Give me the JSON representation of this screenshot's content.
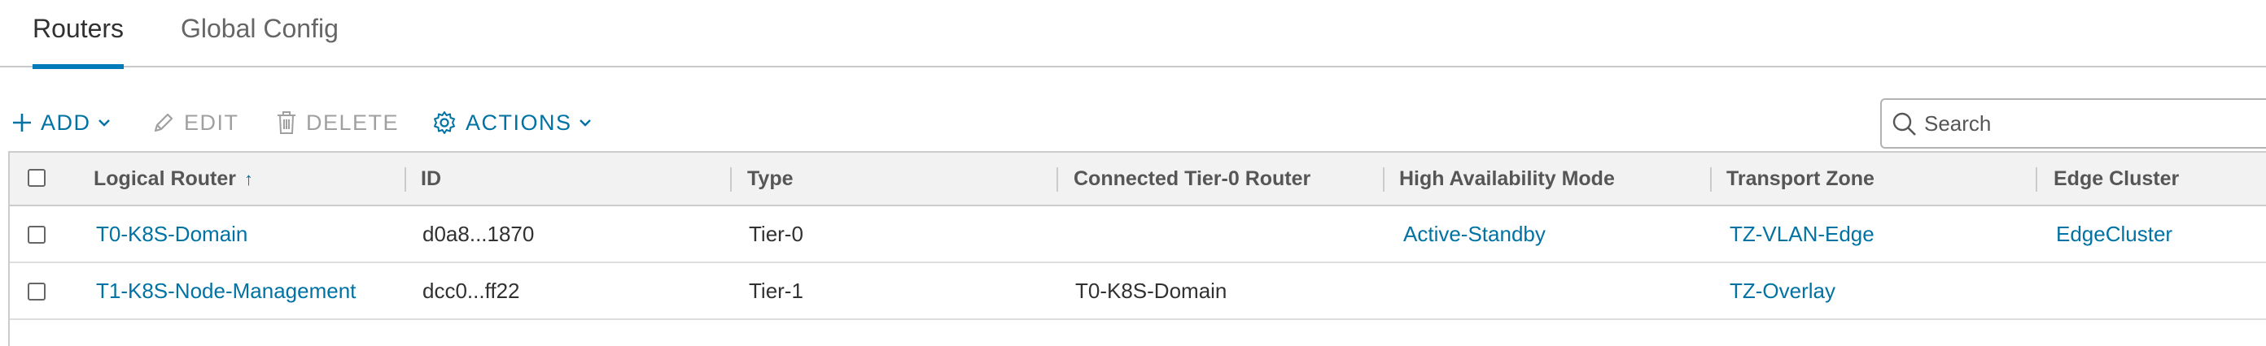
{
  "tabs": [
    {
      "label": "Routers",
      "active": true
    },
    {
      "label": "Global Config",
      "active": false
    }
  ],
  "toolbar": {
    "add_label": "ADD",
    "edit_label": "EDIT",
    "delete_label": "DELETE",
    "actions_label": "ACTIONS"
  },
  "search": {
    "placeholder": "Search",
    "value": ""
  },
  "table": {
    "columns": [
      "Logical Router",
      "ID",
      "Type",
      "Connected Tier-0 Router",
      "High Availability Mode",
      "Transport Zone",
      "Edge Cluster"
    ],
    "sort_indicator": "↑",
    "rows": [
      {
        "logical_router": "T0-K8S-Domain",
        "id": "d0a8...1870",
        "type": "Tier-0",
        "connected_tier0": "",
        "ha_mode": "Active-Standby",
        "transport_zone": "TZ-VLAN-Edge",
        "edge_cluster": "EdgeCluster"
      },
      {
        "logical_router": "T1-K8S-Node-Management",
        "id": "dcc0...ff22",
        "type": "Tier-1",
        "connected_tier0": "T0-K8S-Domain",
        "ha_mode": "",
        "transport_zone": "TZ-Overlay",
        "edge_cluster": ""
      }
    ]
  },
  "colors": {
    "accent": "#0072a3",
    "tab_underline": "#0079b8",
    "header_bg": "#f2f2f2"
  }
}
